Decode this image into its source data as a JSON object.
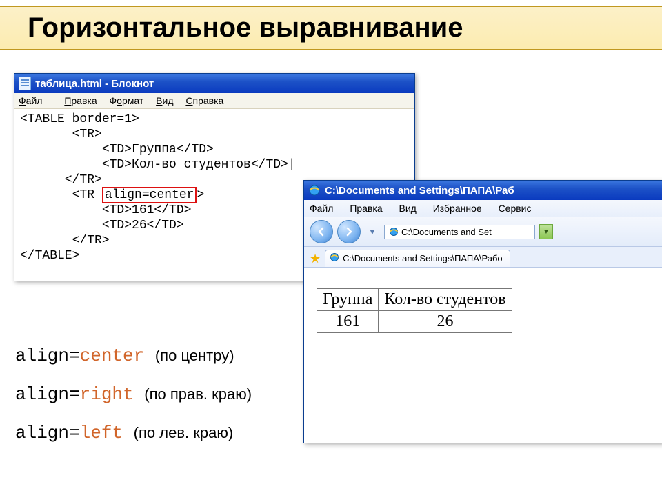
{
  "slide": {
    "title": "Горизонтальное выравнивание"
  },
  "notepad": {
    "title": "таблица.html - Блокнот",
    "menu": {
      "file": "Файл",
      "edit": "Правка",
      "format": "Формат",
      "view": "Вид",
      "help": "Справка"
    },
    "code": {
      "l1": "<TABLE border=1>",
      "l2": "       <TR>",
      "l3": "           <TD>Группа</TD>",
      "l4": "           <TD>Кол-во студентов</TD>",
      "l4c": "|",
      "l5": "      </TR>",
      "l6a": "       <TR ",
      "l6b": "align=center",
      "l6c": ">",
      "l7": "           <TD>161</TD>",
      "l8": "           <TD>26</TD>",
      "l9": "       </TR>",
      "l10": "</TABLE>"
    }
  },
  "ie": {
    "title": "C:\\Documents and Settings\\ПАПА\\Раб",
    "menu": {
      "file": "Файл",
      "edit": "Правка",
      "view": "Вид",
      "fav": "Избранное",
      "tools": "Сервис"
    },
    "address_short": "C:\\Documents and Set",
    "tab_text": "C:\\Documents and Settings\\ПАПА\\Рабо",
    "table": {
      "h1": "Группа",
      "h2": "Кол-во студентов",
      "v1": "161",
      "v2": "26"
    }
  },
  "explain": {
    "kw": "align=",
    "center": "center",
    "center_desc": "(по центру)",
    "right": "right",
    "right_desc": "(по прав. краю)",
    "left": "left",
    "left_desc": "(по лев. краю)"
  }
}
